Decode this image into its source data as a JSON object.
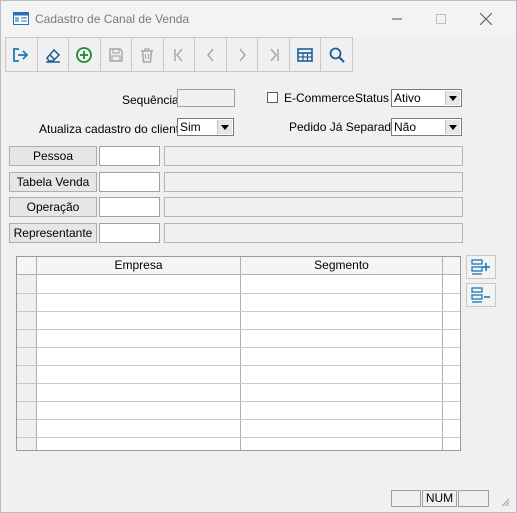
{
  "window": {
    "title": "Cadastro de Canal de Venda"
  },
  "toolbar": {
    "buttons": [
      "exit-icon",
      "clear-icon",
      "add-icon",
      "save-icon",
      "delete-icon",
      "first-icon",
      "previous-icon",
      "next-icon",
      "last-icon",
      "table-view-icon",
      "search-icon"
    ]
  },
  "form": {
    "sequencia_label": "Sequência",
    "sequencia_value": "",
    "ecommerce_label": "E-Commerce",
    "ecommerce_checked": false,
    "status_label": "Status",
    "status_value": "Ativo",
    "atualiza_label": "Atualiza cadastro do cliente",
    "atualiza_value": "Sim",
    "pedido_label": "Pedido Já Separado",
    "pedido_value": "Não"
  },
  "lookups": [
    {
      "label": "Pessoa",
      "code": "",
      "description": ""
    },
    {
      "label": "Tabela Venda",
      "code": "",
      "description": ""
    },
    {
      "label": "Operação",
      "code": "",
      "description": ""
    },
    {
      "label": "Representante",
      "code": "",
      "description": ""
    }
  ],
  "grid": {
    "columns": [
      "Empresa",
      "Segmento"
    ],
    "rows": []
  },
  "side_buttons": [
    "add-row-icon",
    "remove-row-icon"
  ],
  "statusbar": {
    "num_label": "NUM"
  },
  "colors": {
    "accent": "#1a7bb9",
    "add_green": "#1d8a3a"
  }
}
